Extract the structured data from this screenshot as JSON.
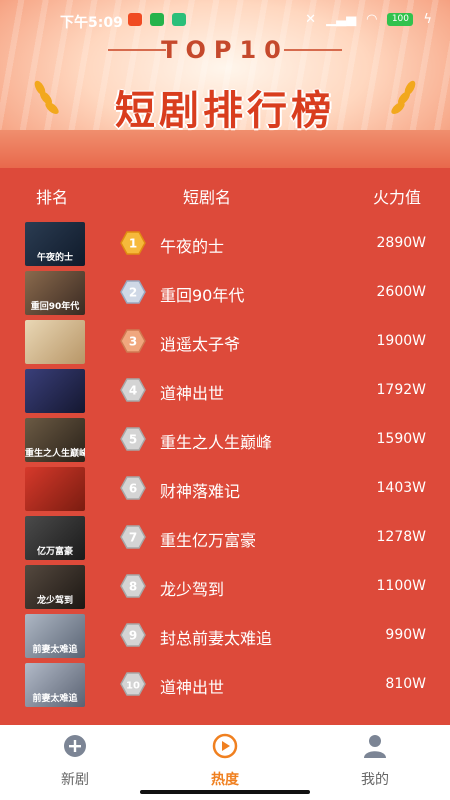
{
  "status_bar": {
    "time": "下午5:09",
    "battery": "100",
    "battery_color": "#31c24d"
  },
  "header": {
    "top_label": "TOP10",
    "title": "短剧排行榜"
  },
  "table": {
    "columns": [
      "排名",
      "短剧名",
      "火力值"
    ],
    "rows": [
      {
        "rank": "1",
        "name": "午夜的士",
        "value": "2890W",
        "thumb_text": "午夜的士",
        "medal": "gold"
      },
      {
        "rank": "2",
        "name": "重回90年代",
        "value": "2600W",
        "thumb_text": "重回90年代",
        "medal": "silver"
      },
      {
        "rank": "3",
        "name": "逍遥太子爷",
        "value": "1900W",
        "thumb_text": "",
        "medal": "bronze"
      },
      {
        "rank": "4",
        "name": "道神出世",
        "value": "1792W",
        "thumb_text": "",
        "medal": "gray"
      },
      {
        "rank": "5",
        "name": "重生之人生巅峰",
        "value": "1590W",
        "thumb_text": "重生之人生巅峰",
        "medal": "gray"
      },
      {
        "rank": "6",
        "name": "财神落难记",
        "value": "1403W",
        "thumb_text": "",
        "medal": "gray"
      },
      {
        "rank": "7",
        "name": "重生亿万富豪",
        "value": "1278W",
        "thumb_text": "亿万富豪",
        "medal": "gray"
      },
      {
        "rank": "8",
        "name": "龙少驾到",
        "value": "1100W",
        "thumb_text": "龙少驾到",
        "medal": "gray"
      },
      {
        "rank": "9",
        "name": "封总前妻太难追",
        "value": "990W",
        "thumb_text": "前妻太难追",
        "medal": "gray"
      },
      {
        "rank": "10",
        "name": "道神出世",
        "value": "810W",
        "thumb_text": "前妻太难追",
        "medal": "gray"
      }
    ]
  },
  "nav": {
    "items": [
      {
        "label": "新剧",
        "icon": "plus-circle-icon"
      },
      {
        "label": "热度",
        "icon": "play-circle-icon"
      },
      {
        "label": "我的",
        "icon": "person-icon"
      }
    ],
    "active_index": 1,
    "active_color": "#f08020"
  },
  "colors": {
    "panel": "#dd4a3a",
    "title": "#d93d1e"
  }
}
